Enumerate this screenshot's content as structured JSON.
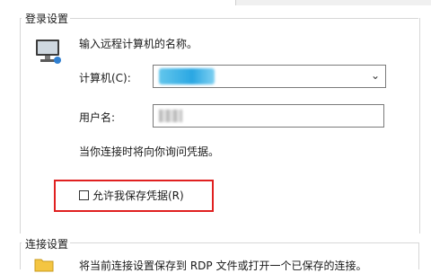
{
  "login_settings": {
    "title": "登录设置",
    "prompt": "输入远程计算机的名称。",
    "computer_label": "计算机(C):",
    "username_label": "用户名:",
    "hint": "当你连接时将向你询问凭据。",
    "save_credentials_label": "允许我保存凭据(R)",
    "save_credentials_checked": false
  },
  "connection_settings": {
    "title": "连接设置",
    "description": "将当前连接设置保存到 RDP 文件或打开一个已保存的连接。"
  },
  "colors": {
    "highlight": "#e02020",
    "redacted_computer": "#2aa7e3"
  },
  "icons": [
    "monitor-icon",
    "chevron-down-icon",
    "folder-icon"
  ]
}
